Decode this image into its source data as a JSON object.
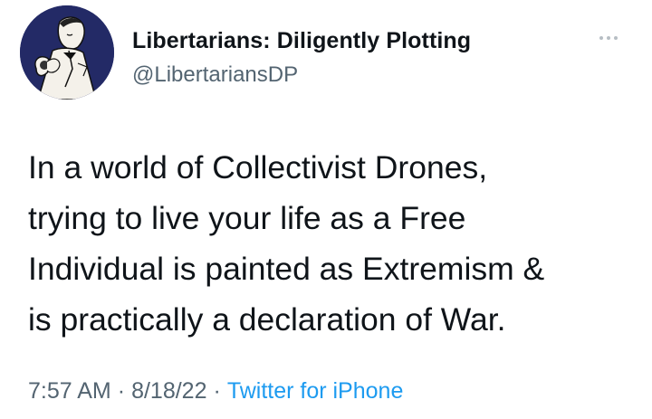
{
  "author": {
    "display_name": "Libertarians: Diligently Plotting",
    "handle": "@LibertariansDP"
  },
  "tweet": {
    "lines": [
      "In a world of Collectivist Drones,",
      "trying to live your life as a Free",
      "Individual is painted as Extremism &",
      "is practically a declaration of War."
    ]
  },
  "meta": {
    "time": "7:57 AM",
    "separator": "·",
    "date": "8/18/22",
    "source": "Twitter for iPhone"
  },
  "colors": {
    "avatar_bg": "#232a66",
    "muted": "#536471",
    "link": "#1d9bf0",
    "text": "#0f1419"
  },
  "icons": {
    "more": "more-horizontal-icon"
  }
}
